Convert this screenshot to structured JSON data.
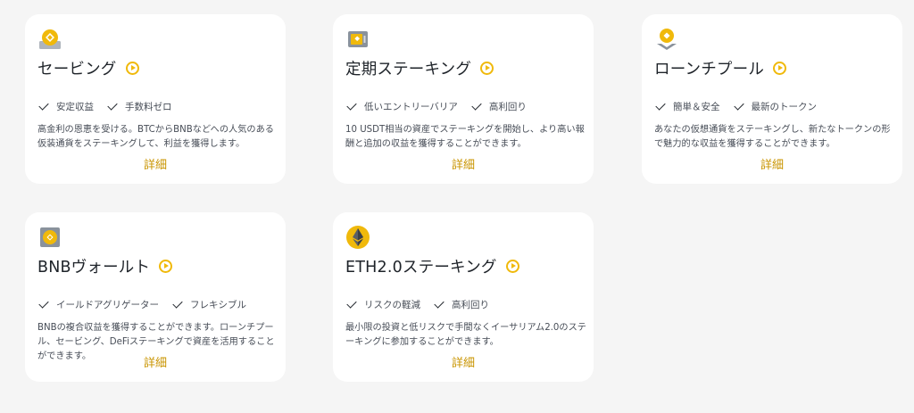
{
  "accent_color": "#f0b90b",
  "link_color": "#c99400",
  "cards": [
    {
      "icon": "savings-coin-icon",
      "title": "セービング",
      "features": [
        "安定収益",
        "手数料ゼロ"
      ],
      "description": "高金利の恩恵を受ける。BTCからBNBなどへの人気のある仮装通貨をステーキングして、利益を獲得します。",
      "detail_label": "詳細"
    },
    {
      "icon": "staking-vault-icon",
      "title": "定期ステーキング",
      "features": [
        "低いエントリーバリア",
        "高利回り"
      ],
      "description": "10 USDT相当の資産でステーキングを開始し、より高い報酬と追加の収益を獲得することができます。",
      "detail_label": "詳細"
    },
    {
      "icon": "launchpool-icon",
      "title": "ローンチプール",
      "features": [
        "簡単＆安全",
        "最新のトークン"
      ],
      "description": "あなたの仮想通貨をステーキングし、新たなトークンの形で魅力的な収益を獲得することができます。",
      "detail_label": "詳細"
    },
    {
      "icon": "bnb-vault-icon",
      "title": "BNBヴォールト",
      "features": [
        "イールドアグリゲーター",
        "フレキシブル"
      ],
      "description": "BNBの複合収益を獲得することができます。ローンチプール、セービング、DeFiステーキングで資産を活用することができます。",
      "detail_label": "詳細"
    },
    {
      "icon": "ethereum-icon",
      "title": "ETH2.0ステーキング",
      "features": [
        "リスクの軽減",
        "高利回り"
      ],
      "description": "最小限の投資と低リスクで手間なくイーサリアム2.0のステーキングに参加することができます。",
      "detail_label": "詳細"
    }
  ]
}
